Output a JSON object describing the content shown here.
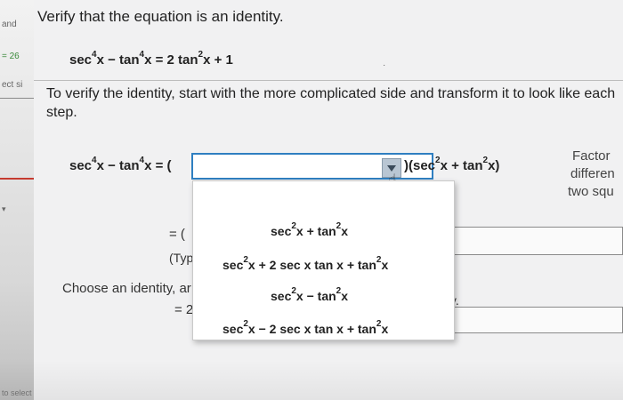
{
  "question": {
    "title": "Verify that the equation is an identity.",
    "instructions": "To verify the identity, start with the more complicated side and transform it to look like each step."
  },
  "equation": {
    "lhs_sec": "sec",
    "lhs_p1": "4",
    "lhs_x1": "x − tan",
    "lhs_p2": "4",
    "lhs_x2": "x = 2 tan",
    "rhs_p": "2",
    "rhs_tail": "x + 1"
  },
  "step1": {
    "sec": "sec",
    "p1": "4",
    "x1": "x − tan",
    "p2": "4",
    "eq": "x = (",
    "rhs_open": ")(",
    "rhs_sec": "sec",
    "rhs_p1": "2",
    "rhs_mid": "x + tan",
    "rhs_p2": "2",
    "rhs_close": "x)"
  },
  "side_note": {
    "l1": "Factor",
    "l2": "differen",
    "l3": "two squ"
  },
  "steps": {
    "eq_open": "= (",
    "type_hint": "(Typ",
    "choose_identity": "Choose an identity, ar",
    "eq2": "= 2",
    "simplify": "fy."
  },
  "dropdown": {
    "options": [
      {
        "a": "sec",
        "p1": "2",
        "b": "x + tan",
        "p2": "2",
        "c": "x"
      },
      {
        "a": "sec",
        "p1": "2",
        "b": "x + 2 sec x  tan x + tan",
        "p2": "2",
        "c": "x"
      },
      {
        "a": "sec",
        "p1": "2",
        "b": "x − tan",
        "p2": "2",
        "c": "x"
      },
      {
        "a": "sec",
        "p1": "2",
        "b": "x − 2 sec x  tan x + tan",
        "p2": "2",
        "c": "x"
      }
    ]
  },
  "left_strip": {
    "t1": "and",
    "t2": "= 26",
    "t3": "ect si",
    "t4": "to select you"
  },
  "colors": {
    "accent": "#2f7fc1",
    "strip_red": "#c53a2f"
  }
}
